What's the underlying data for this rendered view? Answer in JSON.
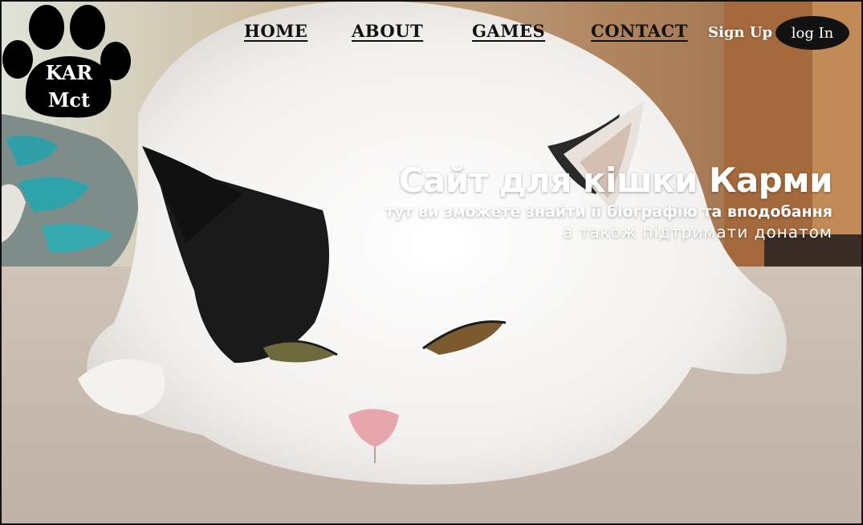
{
  "brand": {
    "logo_text_line1": "KAR",
    "logo_text_line2": "Mct",
    "icon": "paw-icon"
  },
  "nav": {
    "items": [
      {
        "label": "HOME"
      },
      {
        "label": "ABOUT"
      },
      {
        "label": "GAMES"
      },
      {
        "label": "CONTACT"
      }
    ],
    "signup_label": "Sign Up",
    "login_label": "log In"
  },
  "hero": {
    "title": "Сайт для кішки Карми",
    "subtitle": "тут ви зможете знайти її біографію та вподобання",
    "subtitle2": "а також підтримати донатом",
    "image": "photo of a white and black cat lying on a carpet"
  },
  "colors": {
    "nav_text": "#111111",
    "button_bg": "#121212",
    "hero_text": "#ffffff"
  }
}
